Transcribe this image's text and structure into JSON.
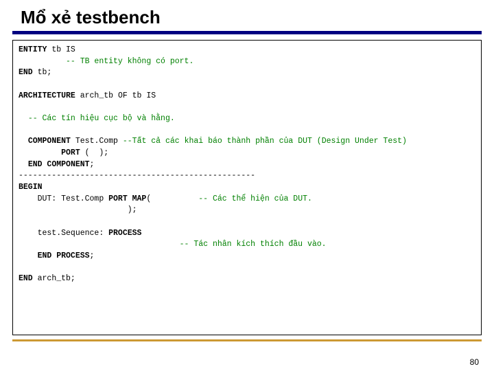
{
  "title": "Mổ xẻ testbench",
  "code": {
    "l1_kw": "ENTITY",
    "l1_rest": " tb IS",
    "l2_cm": "-- TB entity không có port.",
    "l3_kw": "END",
    "l3_rest": " tb;",
    "l5_kw": "ARCHITECTURE",
    "l5_rest": " arch_tb OF tb IS",
    "l7_cm": "-- Các tín hiệu cục bộ và hằng.",
    "l9_kw": "COMPONENT",
    "l9_rest": " Test.Comp ",
    "l9_cm": "--Tất cả các khai báo thành phần của DUT (Design Under Test)",
    "l10_kw": "PORT",
    "l10_rest": " (  );",
    "l11_kw1": "END",
    "l11_kw2": " COMPONENT",
    "l11_rest": ";",
    "l12": "--------------------------------------------------",
    "l13_kw": "BEGIN",
    "l14_a": "    DUT: Test.Comp ",
    "l14_kw": "PORT MAP",
    "l14_b": "(          ",
    "l14_cm": "-- Các thể hiện của DUT.",
    "l15": "                       );",
    "l17_a": "    test.Sequence: ",
    "l17_kw": "PROCESS",
    "l18_cm": "-- Tác nhân kích thích đầu vào.",
    "l19_kw": "END PROCESS",
    "l19_rest": ";",
    "l21_kw": "END",
    "l21_rest": " arch_tb;"
  },
  "page_number": "80"
}
